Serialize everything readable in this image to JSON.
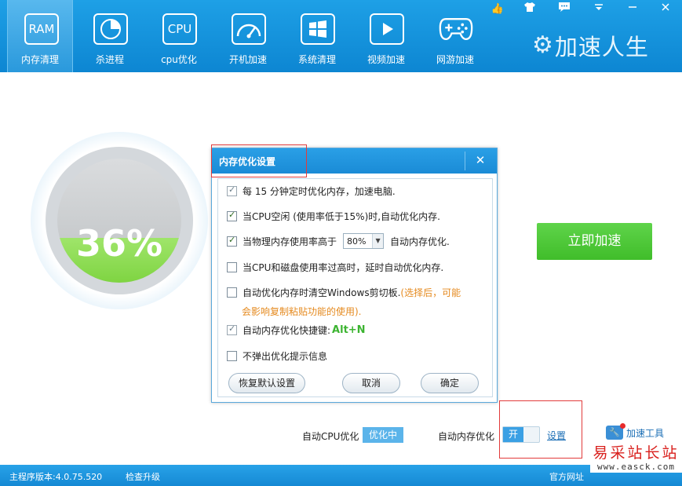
{
  "toolbar": {
    "items": [
      {
        "label": "内存清理",
        "icon_text": "RAM",
        "icon": "ram-icon"
      },
      {
        "label": "杀进程",
        "icon": "pie-chart-icon"
      },
      {
        "label": "cpu优化",
        "icon_text": "CPU",
        "icon": "cpu-icon"
      },
      {
        "label": "开机加速",
        "icon": "speedometer-icon"
      },
      {
        "label": "系统清理",
        "icon": "windows-logo-icon"
      },
      {
        "label": "视频加速",
        "icon": "play-icon"
      },
      {
        "label": "网游加速",
        "icon": "gamepad-icon"
      }
    ],
    "active": "内存清理"
  },
  "brand": {
    "name": "加速人生"
  },
  "gauge": {
    "text": "36%",
    "value_percent": 36
  },
  "speed_button": {
    "label": "立即加速"
  },
  "bottom_controls": {
    "auto_cpu_label": "自动CPU优化",
    "auto_cpu_state": "优化中",
    "auto_mem_label": "自动内存优化",
    "toggle_label": "开",
    "setting_link": "设置",
    "tools_label": "加速工具"
  },
  "status": {
    "version": "主程序版本:4.0.75.520",
    "update": "检查升级",
    "site": "官方网址"
  },
  "watermark": {
    "line1": "易采站长站",
    "line2": "www.easck.com"
  },
  "dialog": {
    "title": "内存优化设置",
    "options": [
      {
        "text": "每 15 分钟定时优化内存，加速电脑.",
        "checked": true
      },
      {
        "text": "当CPU空闲 (使用率低于15%)时,自动优化内存.",
        "checked": true
      },
      {
        "text_before": "当物理内存使用率高于",
        "select_value": "80%",
        "text_after": "自动内存优化.",
        "checked": true
      },
      {
        "text": "当CPU和磁盘使用率过高时，延时自动优化内存.",
        "checked": false
      },
      {
        "text": "自动优化内存时清空Windows剪切板.",
        "warn_1": "(选择后，可能",
        "warn_2": "会影响复制粘贴功能的使用).",
        "checked": false
      },
      {
        "text": "自动内存优化快捷键:",
        "hotkey": "Alt+N",
        "checked": true
      },
      {
        "text": "不弹出优化提示信息",
        "checked": false
      }
    ],
    "buttons": {
      "restore": "恢复默认设置",
      "cancel": "取消",
      "ok": "确定"
    }
  },
  "colors": {
    "accent_blue": "#1a8bd6",
    "gauge_green": "#7fd442",
    "button_green": "#40bd2a",
    "warning_orange": "#e58a1f",
    "annotation_red": "#e23b3b"
  }
}
